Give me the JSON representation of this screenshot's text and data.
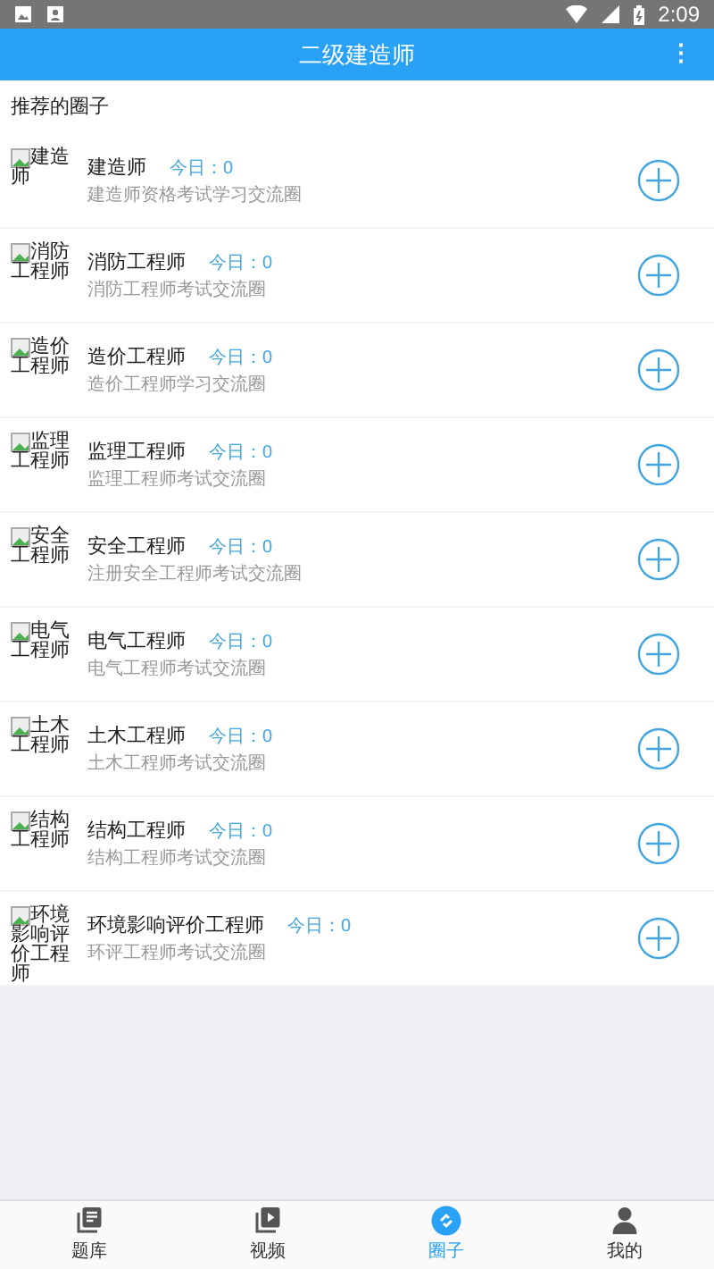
{
  "status_bar": {
    "time": "2:09"
  },
  "header": {
    "title": "二级建造师",
    "menu": "⋮"
  },
  "section_title": "推荐的圈子",
  "circles": [
    {
      "alt": "建造师",
      "name": "建造师",
      "today": "今日：0",
      "desc": "建造师资格考试学习交流圈"
    },
    {
      "alt": "消防工程师",
      "name": "消防工程师",
      "today": "今日：0",
      "desc": "消防工程师考试交流圈"
    },
    {
      "alt": "造价工程师",
      "name": "造价工程师",
      "today": "今日：0",
      "desc": "造价工程师学习交流圈"
    },
    {
      "alt": "监理工程师",
      "name": "监理工程师",
      "today": "今日：0",
      "desc": "监理工程师考试交流圈"
    },
    {
      "alt": "安全工程师",
      "name": "安全工程师",
      "today": "今日：0",
      "desc": "注册安全工程师考试交流圈"
    },
    {
      "alt": "电气工程师",
      "name": "电气工程师",
      "today": "今日：0",
      "desc": "电气工程师考试交流圈"
    },
    {
      "alt": "土木工程师",
      "name": "土木工程师",
      "today": "今日：0",
      "desc": "土木工程师考试交流圈"
    },
    {
      "alt": "结构工程师",
      "name": "结构工程师",
      "today": "今日：0",
      "desc": "结构工程师考试交流圈"
    },
    {
      "alt": "环境影响评价工程师",
      "name": "环境影响评价工程师",
      "today": "今日：0",
      "desc": "环评工程师考试交流圈"
    }
  ],
  "tabs": [
    {
      "kind": "questions",
      "label": "题库",
      "selected": false
    },
    {
      "kind": "video",
      "label": "视频",
      "selected": false
    },
    {
      "kind": "circle",
      "label": "圈子",
      "selected": true
    },
    {
      "kind": "me",
      "label": "我的",
      "selected": false
    }
  ]
}
